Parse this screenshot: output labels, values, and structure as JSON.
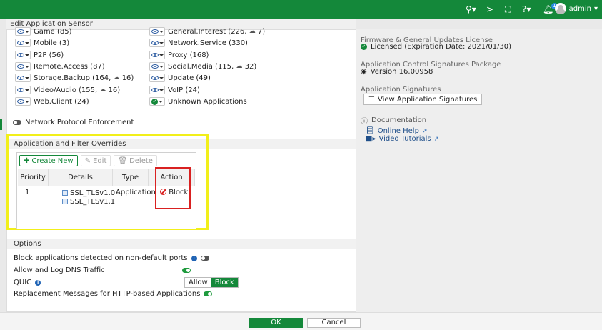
{
  "topbar": {
    "search_icon": "search-icon",
    "cli_icon": "terminal-icon",
    "fullscreen_icon": "fullscreen-icon",
    "help_icon": "help-icon",
    "bell_icon": "bell-icon",
    "notification_count": "1",
    "user": "admin"
  },
  "dialog": {
    "title": "Edit Application Sensor"
  },
  "categories": {
    "game": "Game (85)",
    "mobile": "Mobile (3)",
    "p2p": "P2P (56)",
    "remote_access": "Remote.Access (87)",
    "storage_backup": "Storage.Backup (164,",
    "storage_backup_cloud": "16)",
    "video_audio": "Video/Audio (155,",
    "video_audio_cloud": "16)",
    "web_client": "Web.Client (24)",
    "general_interest": "General.Interest (226,",
    "general_interest_cloud": "7)",
    "network_service": "Network.Service (330)",
    "proxy": "Proxy (168)",
    "social_media": "Social.Media (115,",
    "social_media_cloud": "32)",
    "update": "Update (49)",
    "voip": "VoIP (24)",
    "unknown": "Unknown Applications"
  },
  "network_protocol_enforcement": "Network Protocol Enforcement",
  "overrides": {
    "header": "Application and Filter Overrides",
    "create_new": "Create New",
    "edit": "Edit",
    "delete": "Delete",
    "columns": [
      "Priority",
      "Details",
      "Type",
      "Action"
    ],
    "row": {
      "priority": "1",
      "details": [
        "SSL_TLSv1.0",
        "SSL_TLSv1.1"
      ],
      "type": "Application",
      "action": "Block"
    }
  },
  "options": {
    "header": "Options",
    "block_non_default": "Block applications detected on non-default ports",
    "allow_log_dns": "Allow and Log DNS Traffic",
    "quic": "QUIC",
    "quic_allow": "Allow",
    "quic_block": "Block",
    "replacement_messages": "Replacement Messages for HTTP-based Applications"
  },
  "right": {
    "fw_updates_title": "Firmware & General Updates License",
    "fw_updates_value": "Licensed (Expiration Date: 2021/01/30)",
    "sig_package_title": "Application Control Signatures Package",
    "sig_package_value": "Version 16.00958",
    "app_signatures_title": "Application Signatures",
    "view_signatures": "View Application Signatures",
    "documentation": "Documentation",
    "online_help": "Online Help",
    "video_tutorials": "Video Tutorials"
  },
  "footer": {
    "ok": "OK",
    "cancel": "Cancel"
  }
}
